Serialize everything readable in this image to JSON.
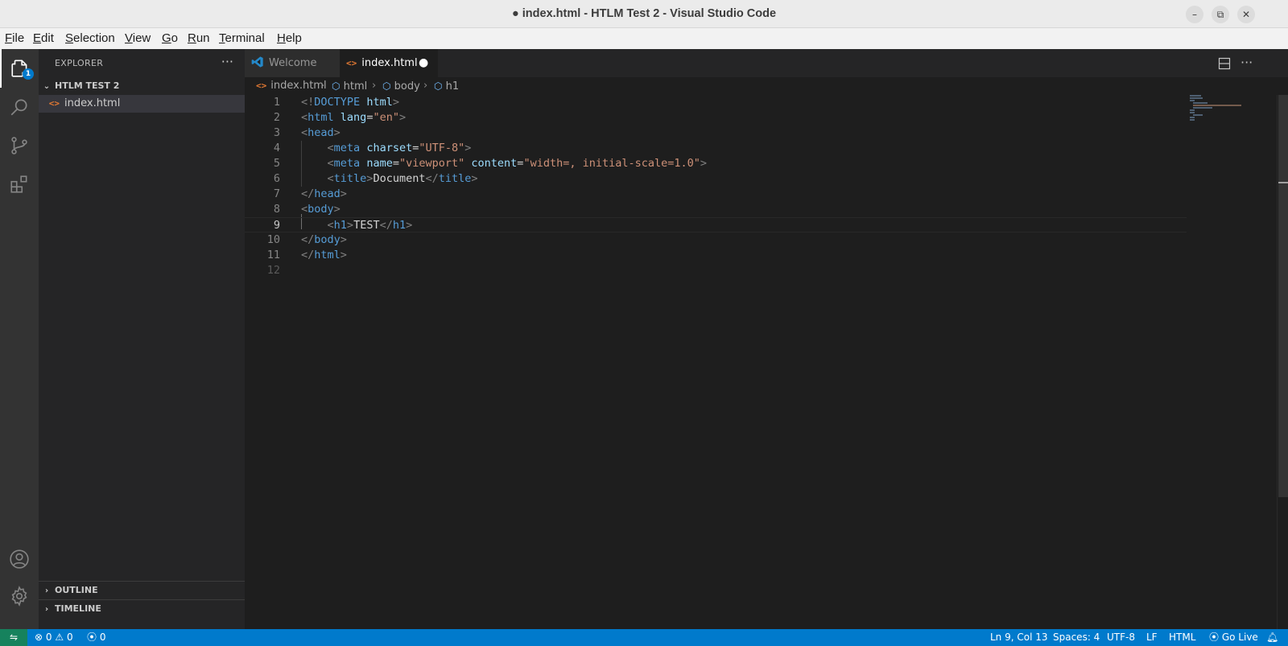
{
  "window": {
    "title": "● index.html - HTLM Test 2 - Visual Studio Code",
    "minimize_glyph": "–",
    "maximize_glyph": "⧉",
    "close_glyph": "✕"
  },
  "menu": [
    "File",
    "Edit",
    "Selection",
    "View",
    "Go",
    "Run",
    "Terminal",
    "Help"
  ],
  "activity_bar": {
    "explorer_badge": "1",
    "icons": [
      "files-icon",
      "search-icon",
      "source-control-icon",
      "extensions-icon",
      "account-icon",
      "gear-icon"
    ]
  },
  "sidebar": {
    "header": "EXPLORER",
    "more": "···",
    "folder": "HTLM TEST 2",
    "file": "index.html",
    "outline": "OUTLINE",
    "timeline": "TIMELINE"
  },
  "tabs": [
    {
      "label": "Welcome",
      "active": false
    },
    {
      "label": "index.html",
      "active": true,
      "dirty": true
    }
  ],
  "breadcrumb": [
    "index.html",
    "html",
    "body",
    "h1"
  ],
  "editor": {
    "line_numbers": [
      "1",
      "2",
      "3",
      "4",
      "5",
      "6",
      "7",
      "8",
      "9",
      "10",
      "11",
      "12"
    ],
    "current_line": 9
  },
  "status": {
    "errors": "0",
    "warnings": "0",
    "ports": "0",
    "position": "Ln 9, Col 13",
    "spaces": "Spaces: 4",
    "encoding": "UTF-8",
    "eol": "LF",
    "language": "HTML",
    "golive": "Go Live"
  },
  "colors": {
    "accent": "#007acc",
    "editor_bg": "#1e1e1e",
    "sidebar_bg": "#252526",
    "activity_bg": "#333333",
    "tag": "#569cd6",
    "attr": "#9cdcfe",
    "string": "#ce9178"
  }
}
